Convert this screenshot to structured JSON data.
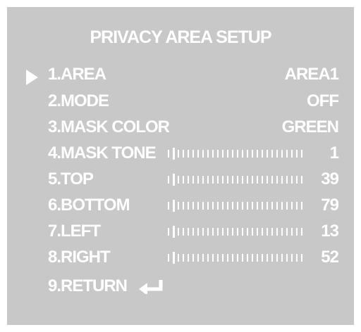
{
  "screen": {
    "title": "PRIVACY AREA SETUP",
    "cursor_icon": "right-triangle-icon",
    "return_icon": "return-enter-icon",
    "background_color": "#c8c8c8",
    "text_color": "#ffffff"
  },
  "menu": [
    {
      "label": "1.AREA",
      "value": "AREA1",
      "selected": true
    },
    {
      "label": "2.MODE",
      "value": "OFF"
    },
    {
      "label": "3.MASK COLOR",
      "value": "GREEN"
    },
    {
      "label": "4.MASK TONE",
      "value": "1",
      "slider": true
    },
    {
      "label": "5.TOP",
      "value": "39",
      "slider": true
    },
    {
      "label": "6.BOTTOM",
      "value": "79",
      "slider": true
    },
    {
      "label": "7.LEFT",
      "value": "13",
      "slider": true
    },
    {
      "label": "8.RIGHT",
      "value": "52",
      "slider": true
    },
    {
      "label": "9.RETURN"
    }
  ]
}
